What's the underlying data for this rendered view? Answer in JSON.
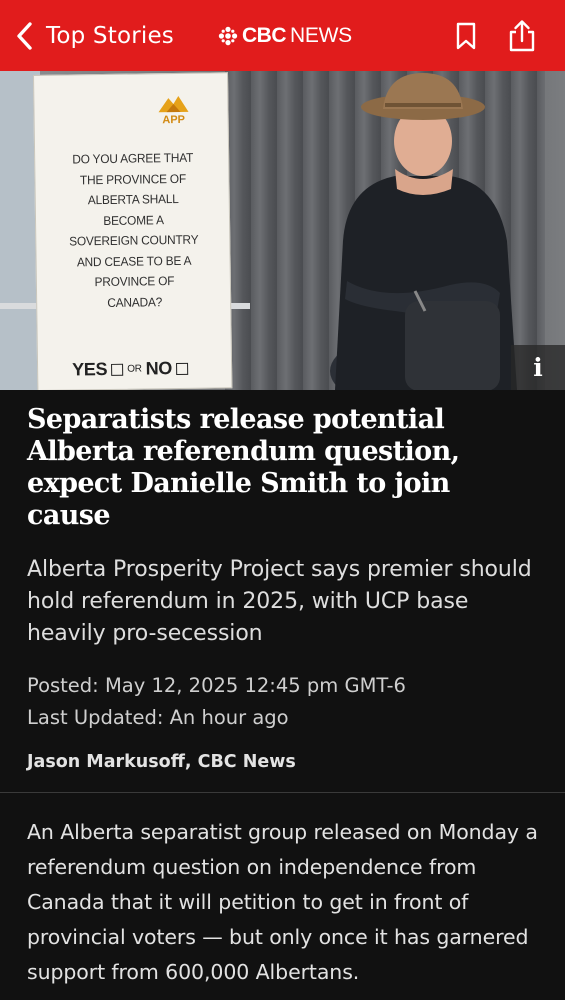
{
  "header": {
    "back_label": "Top Stories",
    "brand_bold": "CBC",
    "brand_light": "NEWS",
    "accent_color": "#e11c1c",
    "icons": [
      "chevron-left-icon",
      "cbc-gem-icon",
      "bookmark-icon",
      "share-icon"
    ]
  },
  "hero": {
    "sign": {
      "logo_text": "APP",
      "question_lines": [
        "DO YOU AGREE THAT",
        "THE PROVINCE OF",
        "ALBERTA SHALL",
        "BECOME A",
        "SOVEREIGN COUNTRY",
        "AND CEASE TO BE A",
        "PROVINCE OF",
        "CANADA?"
      ],
      "yes": "YES",
      "or": "OR",
      "no": "NO"
    },
    "info_label": "i"
  },
  "article": {
    "headline": "Separatists release potential Alberta referendum question, expect Danielle Smith to join cause",
    "dek": "Alberta Prosperity Project says premier should hold referendum in 2025, with UCP base heavily pro-secession",
    "posted": "Posted: May 12, 2025 12:45 pm GMT-6",
    "updated": "Last Updated: An hour ago",
    "byline": "Jason Markusoff, CBC News",
    "body": "An Alberta separatist group released on Monday a referendum question on independence from Canada that it will petition to get in front of provincial voters — but only once it has garnered support from 600,000 Albertans."
  }
}
